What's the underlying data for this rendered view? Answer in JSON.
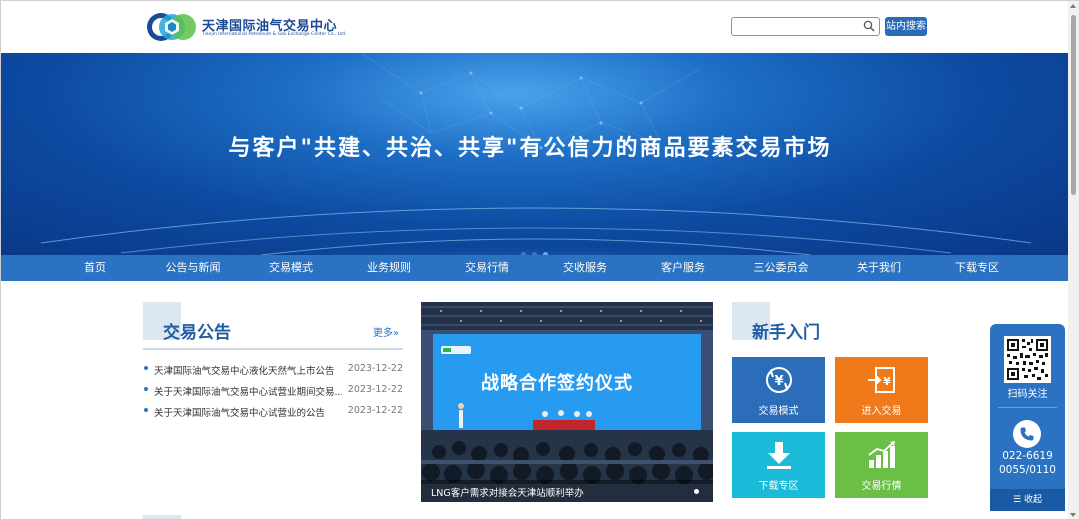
{
  "header": {
    "logo_cn": "天津国际油气交易中心",
    "logo_en": "Tianjin International Petroleum & Gas Exchange Center Co., Ltd.",
    "search_placeholder": "",
    "search_button": "站内搜索"
  },
  "banner": {
    "slogan": "与客户\"共建、共治、共享\"有公信力的商品要素交易市场",
    "slide_count": 3,
    "active_slide": 3
  },
  "nav": {
    "items": [
      "首页",
      "公告与新闻",
      "交易模式",
      "业务规则",
      "交易行情",
      "交收服务",
      "客户服务",
      "三公委员会",
      "关于我们",
      "下载专区"
    ]
  },
  "announcements": {
    "title": "交易公告",
    "more": "更多»",
    "items": [
      {
        "text": "天津国际油气交易中心液化天然气上市公告",
        "date": "2023-12-22"
      },
      {
        "text": "关于天津国际油气交易中心试营业期间交易...",
        "date": "2023-12-22"
      },
      {
        "text": "关于天津国际油气交易中心试营业的公告",
        "date": "2023-12-22"
      }
    ]
  },
  "photo": {
    "screen_title": "战略合作签约仪式",
    "caption": "LNG客户需求对接会天津站顺利举办"
  },
  "guide": {
    "title": "新手入门",
    "tiles": [
      {
        "label": "交易模式",
        "icon": "exchange-icon",
        "color": "#2b6db8"
      },
      {
        "label": "进入交易",
        "icon": "enter-trade-icon",
        "color": "#f07a1a"
      },
      {
        "label": "下载专区",
        "icon": "download-icon",
        "color": "#1bbad9"
      },
      {
        "label": "交易行情",
        "icon": "chart-icon",
        "color": "#6cbf45"
      }
    ]
  },
  "side": {
    "follow": "扫码关注",
    "phone_line1": "022-6619",
    "phone_line2": "0055/0110",
    "collapse": "☰ 收起"
  }
}
